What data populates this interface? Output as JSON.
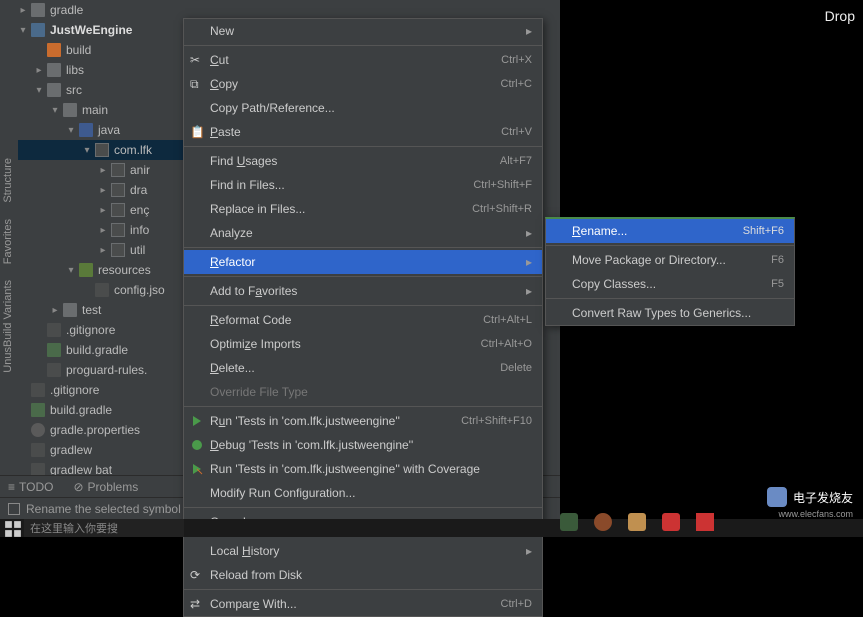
{
  "tree": {
    "gradle": "gradle",
    "project": "JustWeEngine",
    "build": "build",
    "libs": "libs",
    "src": "src",
    "main": "main",
    "java": "java",
    "pkg": "com.lfk",
    "anim": "anir",
    "drawable": "dra",
    "engine": "enç",
    "info": "info",
    "utils": "util",
    "resources": "resources",
    "config": "config.jso",
    "test": "test",
    "gitignore1": ".gitignore",
    "buildg1": "build.gradle",
    "proguard": "proguard-rules.",
    "gitignore2": ".gitignore",
    "buildg2": "build.gradle",
    "gradleprops": "gradle.properties",
    "gradlew": "gradlew",
    "gradlewbat": "gradlew bat"
  },
  "sideTabs": {
    "structure": "Structure",
    "favorites": "Favorites",
    "variants": "UnusBuild Variants"
  },
  "bottom": {
    "todo": "TODO",
    "problems": "Problems"
  },
  "status": "Rename the selected symbol",
  "search_placeholder": "在这里输入你要搜",
  "drop": "Drop",
  "watermark": "电子发烧友",
  "watermark_url": "www.elecfans.com",
  "menu1": {
    "new": "New",
    "cut": "Cut",
    "cut_sc": "Ctrl+X",
    "copy": "Copy",
    "copy_sc": "Ctrl+C",
    "copyref": "Copy Path/Reference...",
    "paste": "Paste",
    "paste_sc": "Ctrl+V",
    "findu": "Find Usages",
    "findu_sc": "Alt+F7",
    "findf": "Find in Files...",
    "findf_sc": "Ctrl+Shift+F",
    "replf": "Replace in Files...",
    "replf_sc": "Ctrl+Shift+R",
    "analyze": "Analyze",
    "refactor": "Refactor",
    "addfav": "Add to Favorites",
    "reformat": "Reformat Code",
    "reformat_sc": "Ctrl+Alt+L",
    "optimize": "Optimize Imports",
    "optimize_sc": "Ctrl+Alt+O",
    "delete": "Delete...",
    "delete_sc": "Delete",
    "override": "Override File Type",
    "runtests": "Run 'Tests in 'com.lfk.justweengine''",
    "runtests_sc": "Ctrl+Shift+F10",
    "debugtests": "Debug 'Tests in 'com.lfk.justweengine''",
    "covtests": "Run 'Tests in 'com.lfk.justweengine'' with Coverage",
    "modifyrun": "Modify Run Configuration...",
    "openin": "Open In",
    "localhist": "Local History",
    "reload": "Reload from Disk",
    "compare": "Compare With...",
    "compare_sc": "Ctrl+D"
  },
  "menu2": {
    "rename": "Rename...",
    "rename_sc": "Shift+F6",
    "move": "Move Package or Directory...",
    "move_sc": "F6",
    "copycls": "Copy Classes...",
    "copycls_sc": "F5",
    "convert": "Convert Raw Types to Generics..."
  }
}
